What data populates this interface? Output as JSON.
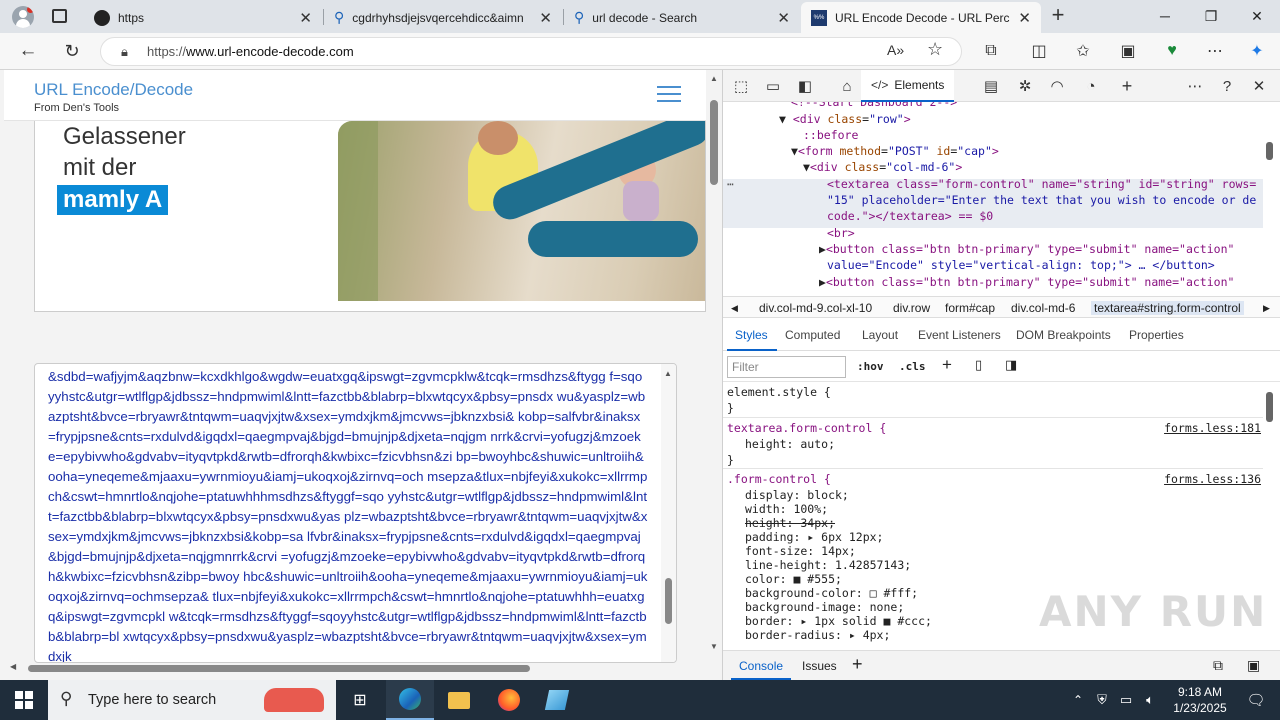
{
  "browser": {
    "tabs": [
      {
        "title": "https",
        "icon": "github-icon",
        "active": false
      },
      {
        "title": "cgdrhyhsdjejsvqercehdicc&aimn",
        "icon": "search-icon",
        "active": false
      },
      {
        "title": "url decode - Search",
        "icon": "search-icon",
        "active": false
      },
      {
        "title": "URL Encode Decode - URL Percen",
        "icon": "site-favicon",
        "active": true
      }
    ],
    "new_tab": "+",
    "address": {
      "scheme": "https://",
      "host": "www.url-encode-decode.com"
    }
  },
  "page": {
    "brand_title": "URL Encode/Decode",
    "brand_subtitle": "From Den's Tools",
    "ad": {
      "line1": "Gelassener",
      "line2": "mit der",
      "highlight": "mamly A"
    },
    "textarea_text": "&sdbd=wafjyjm&aqzbnw=kcxdkhlgo&wgdw=euatxgq&ipswgt=zgvmcpklw&tcqk=rmsdhzs&ftygg f=sqoyyhstc&utgr=wtlflgp&jdbssz=hndpmwiml&lntt=fazctbb&blabrp=blxwtqcyx&pbsy=pnsdx wu&yasplz=wbazptsht&bvce=rbryawr&tntqwm=uaqvjxjtw&xsex=ymdxjkm&jmcvws=jbknzxbsi& kobp=salfvbr&inaksx=frypjpsne&cnts=rxdulvd&igqdxl=qaegmpvaj&bjgd=bmujnjp&djxeta=nqjgm nrrk&crvi=yofugzj&mzoeke=epybivwho&gdvabv=ityqvtpkd&rwtb=dfrorqh&kwbixc=fzicvbhsn&zi bp=bwoyhbc&shuwic=unltroiih&ooha=yneqeme&mjaaxu=ywrnmioyu&iamj=ukoqxoj&zirnvq=och msepza&tlux=nbjfeyi&xukokc=xllrrmpch&cswt=hmnrtlo&nqjohe=ptatuwhhhmsdhzs&ftyggf=sqo yyhstc&utgr=wtlflgp&jdbssz=hndpmwiml&lntt=fazctbb&blabrp=blxwtqcyx&pbsy=pnsdxwu&yas plz=wbazptsht&bvce=rbryawr&tntqwm=uaqvjxjtw&xsex=ymdxjkm&jmcvws=jbknzxbsi&kobp=sa lfvbr&inaksx=frypjpsne&cnts=rxdulvd&igqdxl=qaegmpvaj&bjgd=bmujnjp&djxeta=nqjgmnrrk&crvi =yofugzj&mzoeke=epybivwho&gdvabv=ityqvtpkd&rwtb=dfrorqh&kwbixc=fzicvbhsn&zibp=bwoy hbc&shuwic=unltroiih&ooha=yneqeme&mjaaxu=ywrnmioyu&iamj=ukoqxoj&zirnvq=ochmsepza& tlux=nbjfeyi&xukokc=xllrrmpch&cswt=hmnrtlo&nqjohe=ptatuwhhh=euatxgq&ipswgt=zgvmcpkl w&tcqk=rmsdhzs&ftyggf=sqoyyhstc&utgr=wtlflgp&jdbssz=hndpmwiml&lntt=fazctbb&blabrp=bl xwtqcyx&pbsy=pnsdxwu&yasplz=wbazptsht&bvce=rbryawr&tntqwm=uaqvjxjtw&xsex=ymdxjk"
  },
  "devtools": {
    "elements_tab": "Elements",
    "dom": {
      "l0": "<!--Start Dashboard 2-->",
      "l1_tag": "<div ",
      "l1_attr": "class",
      "l1_val": "\"row\"",
      "l1_end": ">",
      "l2": "::before",
      "l3_tag": "<form ",
      "l3_a1": "method",
      "l3_v1": "\"POST\"",
      "l3_a2": "id",
      "l3_v2": "\"cap\"",
      "l3_end": ">",
      "l4_tag": "<div ",
      "l4_attr": "class",
      "l4_val": "\"col-md-6\"",
      "l4_end": ">",
      "l5": "<textarea class=\"form-control\" name=\"string\" id=\"string\" rows=",
      "l6": "\"15\" placeholder=\"Enter the text that you wish to encode or de",
      "l7": "code.\"></textarea> == $0",
      "l8": "<br>",
      "l9": "<button class=\"btn btn-primary\" type=\"submit\" name=\"action\"",
      "l10": "value=\"Encode\" style=\"vertical-align: top;\"> … </button>",
      "l11": "<button class=\"btn btn-primary\" type=\"submit\" name=\"action\""
    },
    "breadcrumbs": [
      "div.col-md-9.col-xl-10",
      "div.row",
      "form#cap",
      "div.col-md-6",
      "textarea#string.form-control"
    ],
    "subtabs": [
      "Styles",
      "Computed",
      "Layout",
      "Event Listeners",
      "DOM Breakpoints",
      "Properties"
    ],
    "filter_placeholder": "Filter",
    "hov": ":hov",
    "cls": ".cls",
    "styles": {
      "element_style": "element.style {",
      "close": "}",
      "rule1_selector": "textarea.form-control {",
      "rule1_link": "forms.less:181",
      "rule1_props": [
        "height: auto;"
      ],
      "rule2_selector": ".form-control {",
      "rule2_link": "forms.less:136",
      "rule2_props": [
        "display: block;",
        "width: 100%;",
        "height: 34px;",
        "padding: ▸ 6px 12px;",
        "font-size: 14px;",
        "line-height: 1.42857143;",
        "color: ■ #555;",
        "background-color: □ #fff;",
        "background-image: none;",
        "border: ▸ 1px solid ■ #ccc;",
        "border-radius: ▸ 4px;"
      ]
    },
    "drawer": {
      "console": "Console",
      "issues": "Issues"
    }
  },
  "taskbar": {
    "search_placeholder": "Type here to search",
    "time": "9:18 AM",
    "date": "1/23/2025"
  },
  "watermark": "ANY RUN"
}
